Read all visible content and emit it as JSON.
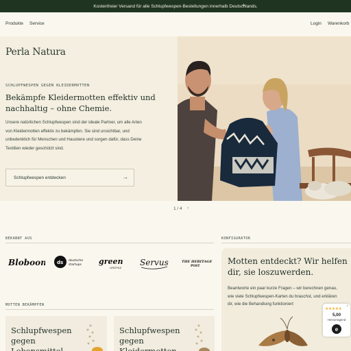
{
  "announcement": {
    "text": "Kostenfreier Versand für alle Schlupfwespen-Bestellungen innerhalb Deutschlands.",
    "close": "+"
  },
  "nav": {
    "left": [
      "Produkte",
      "Service"
    ],
    "right": [
      "Login",
      "Warenkorb"
    ]
  },
  "hero": {
    "logo": "Perla Natura",
    "eyebrow": "SCHLUPFWESPEN GEGEN KLEIDERMOTTEN",
    "headline": "Bekämpfe Kleidermotten effektiv und nachhaltig – ohne Chemie.",
    "body": "Unsere natürlichen Schlupfwespen sind der ideale Partner, um alle Arten von Kleidermotten effektiv zu bekämpfen. Sie sind unsichtbar, und unbedenklich für Menschen und Haustiere und sorgen dafür, dass Deine Textilien wieder geschützt sind.",
    "cta": "Schlupfwespen entdecken",
    "cta_arrow": "→",
    "pager": "1 / 4",
    "pager_next": "›"
  },
  "known_from": {
    "label": "BEKANNT AUS",
    "logos": [
      "Bloboom",
      "deutsche startups",
      "green LIFESTYLE",
      "Servus",
      "THE HERITAGE POST"
    ]
  },
  "moths": {
    "label": "MOTTEN BEKÄMPFEN",
    "cards": [
      "Schlupfwespen gegen Lebensmittel",
      "Schlupfwespen gegen Kleidermotten"
    ]
  },
  "configurator": {
    "label": "KONFIGURATOR",
    "title": "Motten entdeckt? Wir helfen dir, sie loszuwerden.",
    "text": "Beantworte ein paar kurze Fragen – wir berechnen genau, wie viele Schlupfwespen-Karten du brauchst, und erklären dir, wie die Behandlung funktioniert"
  },
  "trust_badge": {
    "stars": "★★★★★",
    "score": "5,00",
    "label": "Hervorragend",
    "seal": "e",
    "rating": 5
  },
  "colors": {
    "accent": "#1f3521",
    "cream": "#faf7ee",
    "hero_bg": "#f4efe0",
    "card_bg": "#f1ecdf"
  }
}
